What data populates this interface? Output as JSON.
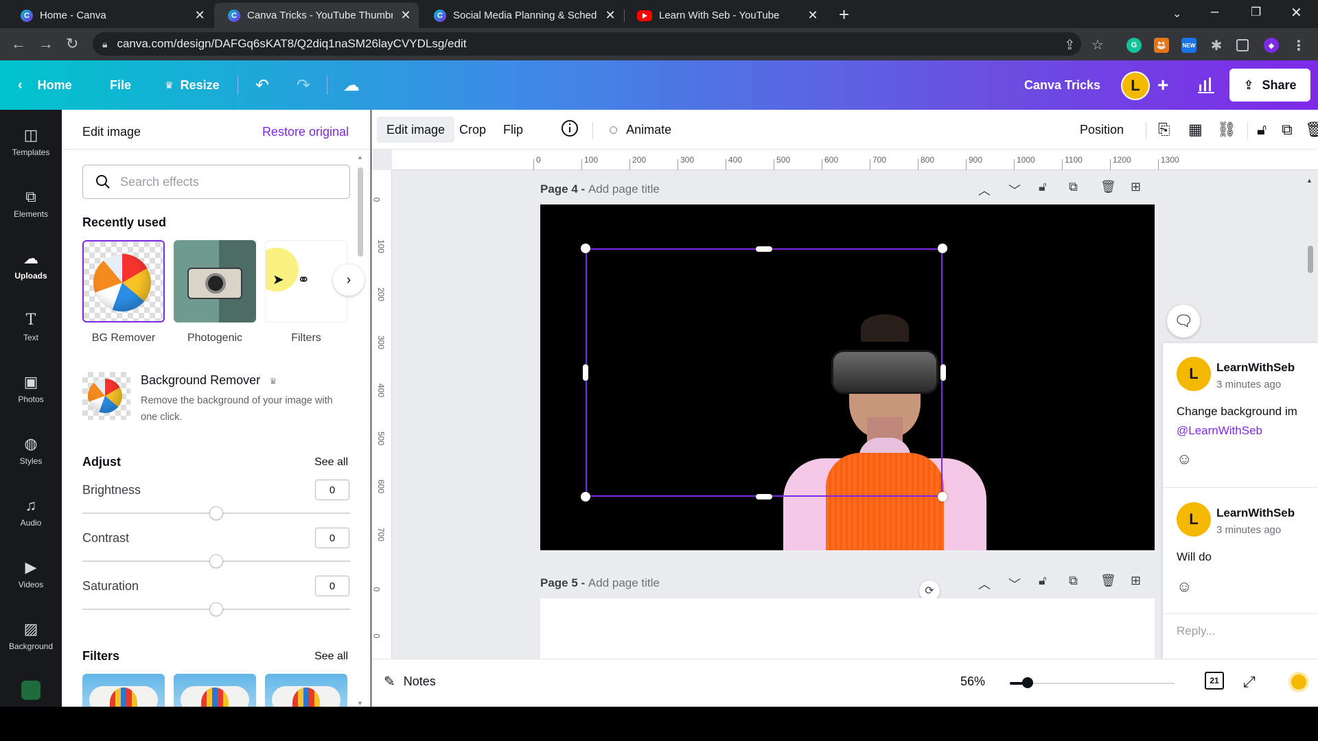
{
  "browser": {
    "tabs": [
      {
        "title": "Home - Canva",
        "favicon": "canva-icon"
      },
      {
        "title": "Canva Tricks - YouTube Thumbna",
        "favicon": "canva-icon"
      },
      {
        "title": "Social Media Planning & Schedul",
        "favicon": "canva-icon"
      },
      {
        "title": "Learn With Seb - YouTube",
        "favicon": "youtube-icon"
      }
    ],
    "active_tab": 1,
    "url": "canva.com/design/DAFGq6sKAT8/Q2diq1naSM26layCVYDLsg/edit"
  },
  "header": {
    "home": "Home",
    "file": "File",
    "resize": "Resize",
    "design_title": "Canva Tricks",
    "avatar_initial": "L",
    "share": "Share"
  },
  "rail": {
    "items": [
      {
        "label": "Templates",
        "icon": "templates-icon"
      },
      {
        "label": "Elements",
        "icon": "elements-icon"
      },
      {
        "label": "Uploads",
        "icon": "uploads-icon"
      },
      {
        "label": "Text",
        "icon": "text-icon"
      },
      {
        "label": "Photos",
        "icon": "photos-icon"
      },
      {
        "label": "Styles",
        "icon": "styles-icon"
      },
      {
        "label": "Audio",
        "icon": "audio-icon"
      },
      {
        "label": "Videos",
        "icon": "videos-icon"
      },
      {
        "label": "Background",
        "icon": "background-icon"
      }
    ],
    "active": "Uploads"
  },
  "panel": {
    "title": "Edit image",
    "restore": "Restore original",
    "search_placeholder": "Search effects",
    "recently_used": "Recently used",
    "recent": [
      {
        "label": "BG Remover"
      },
      {
        "label": "Photogenic"
      },
      {
        "label": "Filters"
      }
    ],
    "bg_remover": {
      "title": "Background Remover",
      "desc": "Remove the background of your image with one click."
    },
    "adjust": {
      "title": "Adjust",
      "see_all": "See all",
      "items": [
        {
          "label": "Brightness",
          "value": "0"
        },
        {
          "label": "Contrast",
          "value": "0"
        },
        {
          "label": "Saturation",
          "value": "0"
        }
      ]
    },
    "filters": {
      "title": "Filters",
      "see_all": "See all"
    }
  },
  "toolbar": {
    "edit_image": "Edit image",
    "crop": "Crop",
    "flip": "Flip",
    "animate": "Animate",
    "position": "Position"
  },
  "rulers": {
    "h": [
      "0",
      "100",
      "200",
      "300",
      "400",
      "500",
      "600",
      "700",
      "800",
      "900",
      "1000",
      "1100",
      "1200",
      "1300"
    ],
    "v": [
      "0",
      "100",
      "200",
      "300",
      "400",
      "500",
      "600",
      "700",
      "0",
      "0"
    ]
  },
  "pages": [
    {
      "label": "Page 4 - ",
      "placeholder": "Add page title"
    },
    {
      "label": "Page 5 - ",
      "placeholder": "Add page title"
    }
  ],
  "comments": [
    {
      "initial": "L",
      "name": "LearnWithSeb",
      "time": "3 minutes ago",
      "text": "Change background im",
      "mention": "@LearnWithSeb"
    },
    {
      "initial": "L",
      "name": "LearnWithSeb",
      "time": "3 minutes ago",
      "text": "Will do"
    }
  ],
  "reply_placeholder": "Reply...",
  "bottom": {
    "notes": "Notes",
    "zoom": "56%",
    "page_count": "21"
  },
  "colors": {
    "accent": "#7d2ae8",
    "header_start": "#00c4cc",
    "header_end": "#7d2ae8",
    "avatar": "#f5b800"
  }
}
